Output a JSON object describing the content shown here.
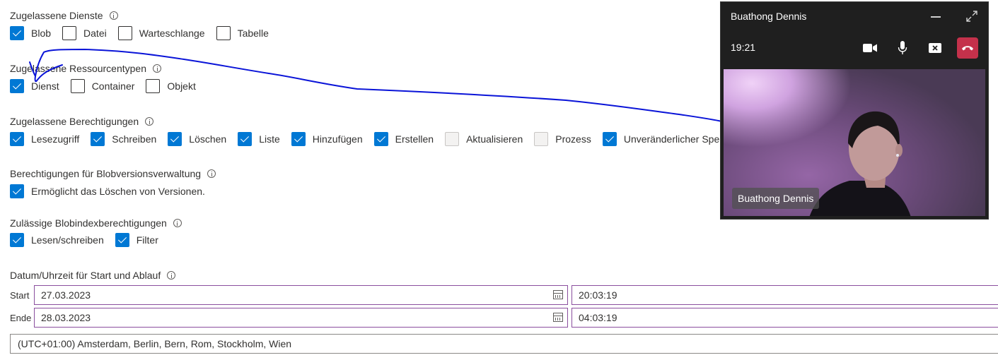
{
  "services": {
    "title": "Zugelassene Dienste",
    "items": [
      {
        "label": "Blob",
        "checked": true
      },
      {
        "label": "Datei",
        "checked": false
      },
      {
        "label": "Warteschlange",
        "checked": false
      },
      {
        "label": "Tabelle",
        "checked": false
      }
    ]
  },
  "resource_types": {
    "title": "Zugelassene Ressourcentypen",
    "items": [
      {
        "label": "Dienst",
        "checked": true
      },
      {
        "label": "Container",
        "checked": false
      },
      {
        "label": "Objekt",
        "checked": false
      }
    ]
  },
  "permissions": {
    "title": "Zugelassene Berechtigungen",
    "items": [
      {
        "label": "Lesezugriff",
        "checked": true
      },
      {
        "label": "Schreiben",
        "checked": true
      },
      {
        "label": "Löschen",
        "checked": true
      },
      {
        "label": "Liste",
        "checked": true
      },
      {
        "label": "Hinzufügen",
        "checked": true
      },
      {
        "label": "Erstellen",
        "checked": true
      },
      {
        "label": "Aktualisieren",
        "checked": false,
        "disabled": true
      },
      {
        "label": "Prozess",
        "checked": false,
        "disabled": true
      },
      {
        "label": "Unveränderlicher Speicher",
        "checked": true
      }
    ]
  },
  "blob_versioning": {
    "title": "Berechtigungen für Blobversionsverwaltung",
    "items": [
      {
        "label": "Ermöglicht das Löschen von Versionen.",
        "checked": true
      }
    ]
  },
  "blob_index": {
    "title": "Zulässige Blobindexberechtigungen",
    "items": [
      {
        "label": "Lesen/schreiben",
        "checked": true
      },
      {
        "label": "Filter",
        "checked": true
      }
    ]
  },
  "datetime": {
    "title": "Datum/Uhrzeit für Start und Ablauf",
    "start_label": "Start",
    "start_date": "27.03.2023",
    "start_time": "20:03:19",
    "end_label": "Ende",
    "end_date": "28.03.2023",
    "end_time": "04:03:19",
    "timezone": "(UTC+01:00) Amsterdam, Berlin, Bern, Rom, Stockholm, Wien"
  },
  "call": {
    "caller_name": "Buathong Dennis",
    "duration": "19:21",
    "participant_tag": "Buathong Dennis",
    "icons": [
      "minimize-icon",
      "expand-icon",
      "camera-icon",
      "microphone-icon",
      "share-screen-stop-icon",
      "hang-up-icon"
    ],
    "end_call_color": "#c4314b"
  },
  "colors": {
    "checkbox_checked": "#0078d4",
    "input_focus_border": "#8a4e9e",
    "annotation_stroke": "#0a14d8"
  }
}
